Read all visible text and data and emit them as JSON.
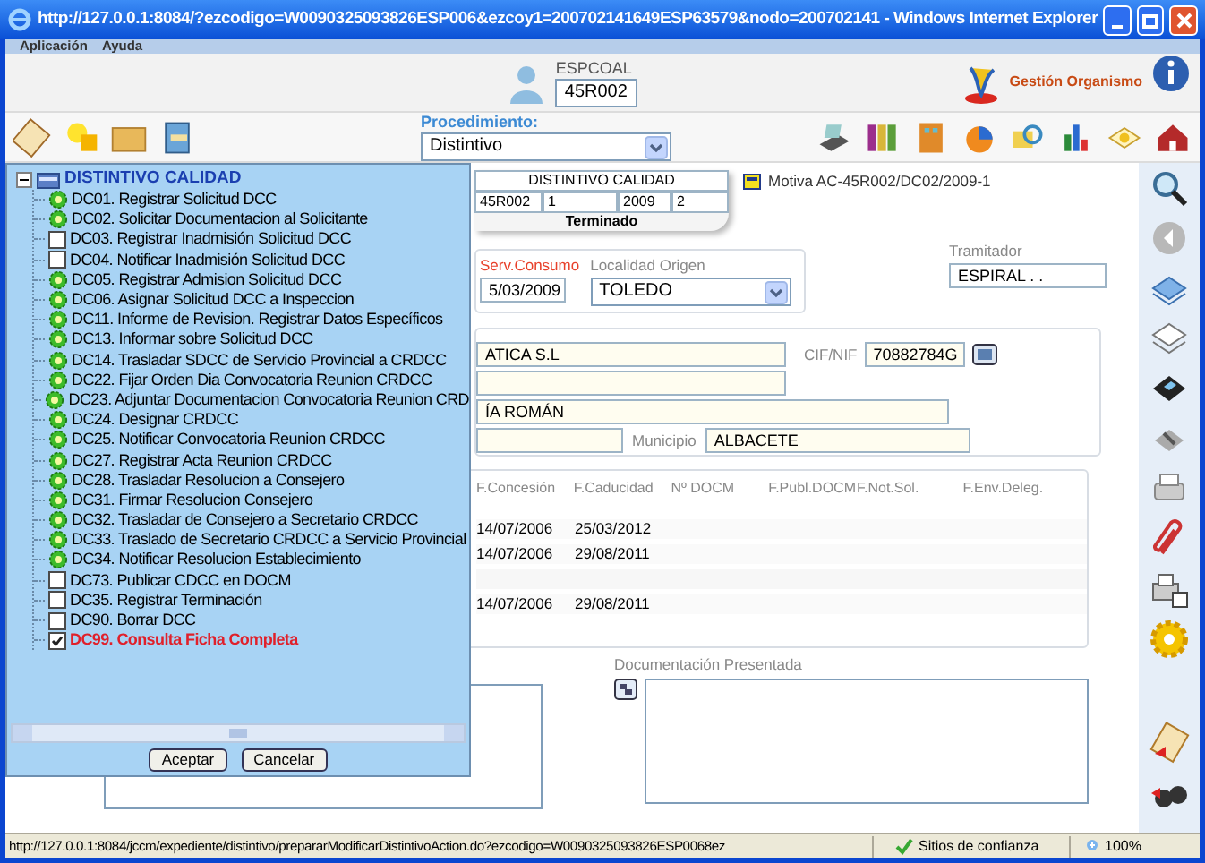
{
  "window": {
    "title": "http://127.0.0.1:8084/?ezcodigo=W0090325093826ESP006&ezcoy1=200702141649ESP63579&nodo=200702141 - Windows Internet Explorer"
  },
  "menu": [
    "Aplicación",
    "Ayuda"
  ],
  "header": {
    "user": "ESPCOAL",
    "office": "45R002",
    "app_name": "Gestión Organismo"
  },
  "toolbar": {
    "procedure_label": "Procedimiento:",
    "procedure": "Distintivo"
  },
  "record": {
    "title": "DISTINTIVO CALIDAD",
    "cells": [
      "45R002",
      "1",
      "2009",
      "2"
    ],
    "status": "Terminado",
    "motive": "Motiva AC-45R002/DC02/2009-1"
  },
  "origin": {
    "date_label": "Serv.Consumo",
    "date": "5/03/2009",
    "locality_label": "Localidad Origen",
    "locality": "TOLEDO",
    "handler_label": "Tramitador",
    "handler": "ESPIRAL . ."
  },
  "applicant": {
    "name": "ATICA S.L",
    "cif_label": "CIF/NIF",
    "cif": "70882784G",
    "address": "ÍA ROMÁN",
    "municipality_label": "Municipio",
    "municipality": "ALBACETE"
  },
  "awards": {
    "columns": [
      "F.Concesión",
      "F.Caducidad",
      "Nº DOCM",
      "F.Publ.DOCM",
      "F.Not.Sol.",
      "F.Env.Deleg."
    ],
    "rows": [
      {
        "kind": "data",
        "cells": [
          "14/07/2006",
          "25/03/2012"
        ]
      },
      {
        "kind": "data",
        "cells": [
          "14/07/2006",
          "29/08/2011"
        ]
      },
      {
        "kind": "blank"
      },
      {
        "kind": "data",
        "cells": [
          "14/07/2006",
          "29/08/2011"
        ]
      }
    ]
  },
  "documents": {
    "label": "Documentación Presentada"
  },
  "tree": {
    "root": "DISTINTIVO CALIDAD",
    "expanded": true,
    "items": [
      {
        "kind": "task",
        "label": "DC01. Registrar Solicitud DCC"
      },
      {
        "kind": "task",
        "label": "DC02. Solicitar Documentacion al Solicitante"
      },
      {
        "kind": "check",
        "label": "DC03. Registrar Inadmisión Solicitud DCC",
        "checked": false
      },
      {
        "kind": "check",
        "label": "DC04. Notificar Inadmisión Solicitud DCC",
        "checked": false
      },
      {
        "kind": "task",
        "label": "DC05. Registrar Admision Solicitud DCC"
      },
      {
        "kind": "task",
        "label": "DC06. Asignar Solicitud DCC a Inspeccion"
      },
      {
        "kind": "task",
        "label": "DC11. Informe de Revision. Registrar Datos Específicos"
      },
      {
        "kind": "task",
        "label": "DC13. Informar sobre Solicitud DCC"
      },
      {
        "kind": "task",
        "label": "DC14. Trasladar SDCC de Servicio Provincial a CRDCC"
      },
      {
        "kind": "task",
        "label": "DC22. Fijar Orden Dia Convocatoria Reunion CRDCC"
      },
      {
        "kind": "task",
        "label": "DC23. Adjuntar Documentacion Convocatoria Reunion CRD"
      },
      {
        "kind": "task",
        "label": "DC24. Designar CRDCC"
      },
      {
        "kind": "task",
        "label": "DC25. Notificar Convocatoria Reunion CRDCC"
      },
      {
        "kind": "task",
        "label": "DC27. Registrar Acta Reunion CRDCC"
      },
      {
        "kind": "task",
        "label": "DC28. Trasladar Resolucion a Consejero"
      },
      {
        "kind": "task",
        "label": "DC31. Firmar Resolucion Consejero"
      },
      {
        "kind": "task",
        "label": "DC32. Trasladar de Consejero a Secretario CRDCC"
      },
      {
        "kind": "task",
        "label": "DC33. Traslado de Secretario CRDCC a Servicio Provincial"
      },
      {
        "kind": "task",
        "label": "DC34. Notificar Resolucion Establecimiento"
      },
      {
        "kind": "check",
        "label": "DC73. Publicar CDCC en DOCM",
        "checked": false
      },
      {
        "kind": "check",
        "label": "DC35. Registrar Terminación",
        "checked": false
      },
      {
        "kind": "check",
        "label": "DC90. Borrar DCC",
        "checked": false
      },
      {
        "kind": "check",
        "label": "DC99. Consulta Ficha Completa",
        "checked": true
      }
    ]
  },
  "dialog_buttons": [
    "Aceptar",
    "Cancelar"
  ],
  "status_bar": {
    "url": "http://127.0.0.1:8084/jccm/expediente/distintivo/prepararModificarDistintivoAction.do?ezcodigo=W0090325093826ESP0068ez",
    "zone": "Sitios de confianza",
    "zoom": "100%"
  }
}
